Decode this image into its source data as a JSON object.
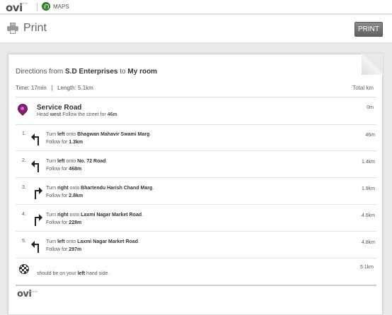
{
  "topbar": {
    "logo": "ovi",
    "logo_sup": "NOKIA",
    "maps_label": "MAPS"
  },
  "header": {
    "title": "Print",
    "print_button": "PRINT"
  },
  "directions": {
    "prefix": "Directions from ",
    "from": "S.D Enterprises",
    "mid": " to ",
    "to": "My room",
    "time": "Time: 17min",
    "sep": "|",
    "length": "Length: 5.1km",
    "total_label": "Total km"
  },
  "start": {
    "name": "Service Road",
    "head": "Head ",
    "dir": "west",
    "follow": " Follow the street for ",
    "dist_bold": "46m",
    "distance": "0m"
  },
  "steps": [
    {
      "num": "1.",
      "turn": "Turn ",
      "dir": "left",
      "onto": " onto ",
      "road": "Bhagwan Mahavir Swami Marg",
      "end": ".",
      "follow": "Follow for ",
      "follow_dist": "1.3km",
      "distance": "46m",
      "arrow": "turn-left-icon"
    },
    {
      "num": "2.",
      "turn": "Turn ",
      "dir": "left",
      "onto": " onto ",
      "road": "No. 72 Road",
      "end": ".",
      "follow": "Follow for ",
      "follow_dist": "468m",
      "distance": "1.4km",
      "arrow": "turn-left-icon"
    },
    {
      "num": "3.",
      "turn": "Turn ",
      "dir": "right",
      "onto": " onto ",
      "road": "Bhartendu Harish Chand Marg",
      "end": ".",
      "follow": "Follow for ",
      "follow_dist": "2.8km",
      "distance": "1.9km",
      "arrow": "turn-right-icon"
    },
    {
      "num": "4.",
      "turn": "Turn ",
      "dir": "right",
      "onto": " onto ",
      "road": "Laxmi Nagar Market Road",
      "end": ".",
      "follow": "Follow for ",
      "follow_dist": "228m",
      "distance": "4.6km",
      "arrow": "turn-right-icon"
    },
    {
      "num": "5.",
      "turn": "Turn ",
      "dir": "left",
      "onto": " onto ",
      "road": "Laxmi Nagar Market Road",
      "end": ".",
      "follow": "Follow for ",
      "follow_dist": "297m",
      "distance": "4.8km",
      "arrow": "turn-left-icon"
    }
  ],
  "end": {
    "pre": "should be on your ",
    "side": "left",
    "post": " hand side.",
    "distance": "5.1km"
  },
  "footer": {
    "logo": "ovi",
    "logo_sup": "NOKIA"
  },
  "colors": {
    "start_pin": "#8a1c74",
    "print_button": "#6f6f6f"
  }
}
